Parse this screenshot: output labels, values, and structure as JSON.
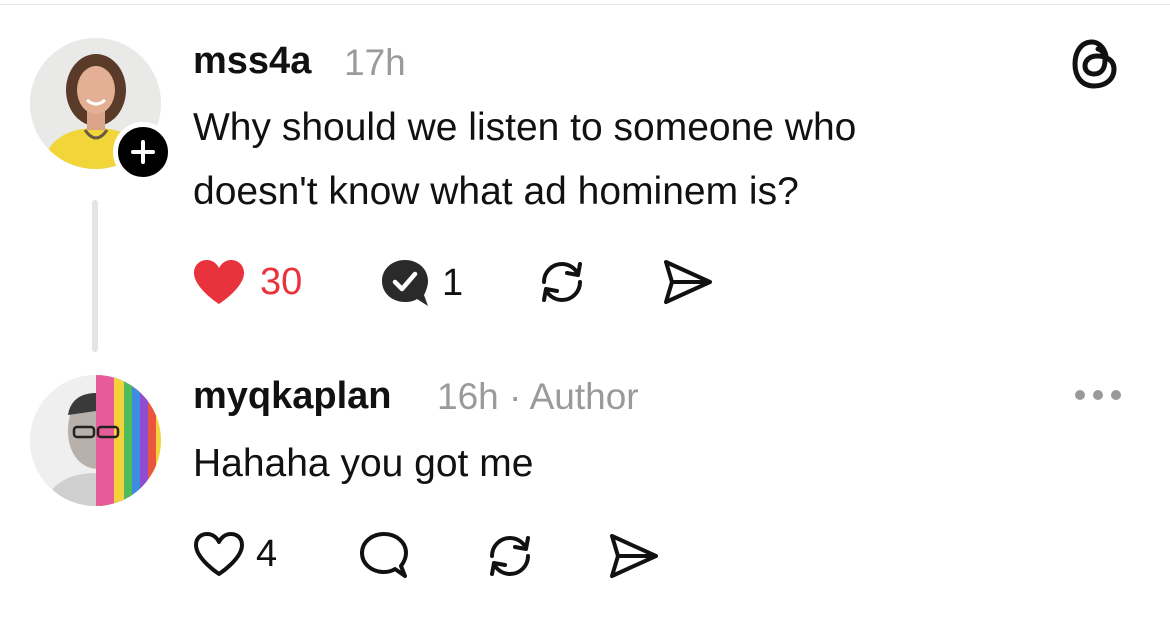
{
  "posts": [
    {
      "username": "mss4a",
      "time": "17h",
      "text_line1": "Why should we listen to someone who",
      "text_line2": "doesn't know what ad hominem is?",
      "likes": "30",
      "replies": "1",
      "liked": true,
      "avatar_icon": "woman-portrait-avatar",
      "follow_icon": "plus-icon"
    },
    {
      "username": "myqkaplan",
      "time": "16h",
      "separator": "·",
      "author_badge": "Author",
      "text": "Hahaha you got me",
      "likes": "4",
      "liked": false,
      "avatar_icon": "psychedelic-portrait-avatar"
    }
  ],
  "colors": {
    "like_red": "#e8323c",
    "text": "#111111",
    "muted": "#9a9a9a",
    "thread_line": "#e4e4e4"
  },
  "icons": {
    "app_logo": "threads-logo-icon",
    "more": "more-options-icon",
    "like": "heart-icon",
    "reply": "comment-icon",
    "repost": "repost-icon",
    "share": "send-icon"
  }
}
